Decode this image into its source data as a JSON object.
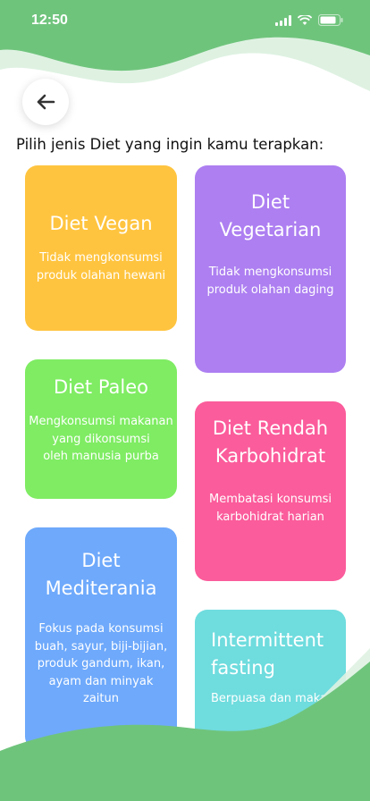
{
  "status_bar": {
    "time": "12:50"
  },
  "page": {
    "title": "Pilih jenis Diet yang ingin kamu terapkan:"
  },
  "colors": {
    "green_wave": "#6fc47c",
    "light_wave": "#dff2e2",
    "vegan": "#ffc43f",
    "vegetarian": "#ad7ff1",
    "paleo": "#7fec63",
    "rendah_karbohidrat": "#fb5c9b",
    "mediterania": "#6ea9fb",
    "intermittent_fasting": "#6fdcde"
  },
  "icons": {
    "back": "arrow-left-icon",
    "signal": "signal-bars-icon",
    "wifi": "wifi-icon",
    "battery": "battery-icon"
  },
  "cards": {
    "vegan": {
      "title_lines": [
        "Diet Vegan"
      ],
      "desc_lines": [
        "Tidak mengkonsumsi",
        "produk olahan hewani"
      ]
    },
    "vegetarian": {
      "title_lines": [
        "Diet",
        "Vegetarian"
      ],
      "desc_lines": [
        "Tidak mengkonsumsi",
        "produk olahan daging"
      ]
    },
    "paleo": {
      "title_lines": [
        "Diet Paleo"
      ],
      "desc_lines": [
        "Mengkonsumsi makanan",
        "yang dikonsumsi",
        "oleh manusia purba"
      ]
    },
    "rendah_karbohidrat": {
      "title_lines": [
        "Diet Rendah",
        "Karbohidrat"
      ],
      "desc_lines": [
        "Membatasi konsumsi",
        "karbohidrat harian"
      ]
    },
    "mediterania": {
      "title_lines": [
        "Diet",
        "Mediterania"
      ],
      "desc_lines": [
        "Fokus pada konsumsi",
        "buah, sayur, biji-bijian,",
        "produk gandum, ikan,",
        "ayam dan minyak",
        "zaitun"
      ]
    },
    "intermittent_fasting": {
      "title_lines": [
        "Intermittent",
        "fasting"
      ],
      "desc_lines": [
        "Berpuasa dan makan"
      ]
    }
  }
}
